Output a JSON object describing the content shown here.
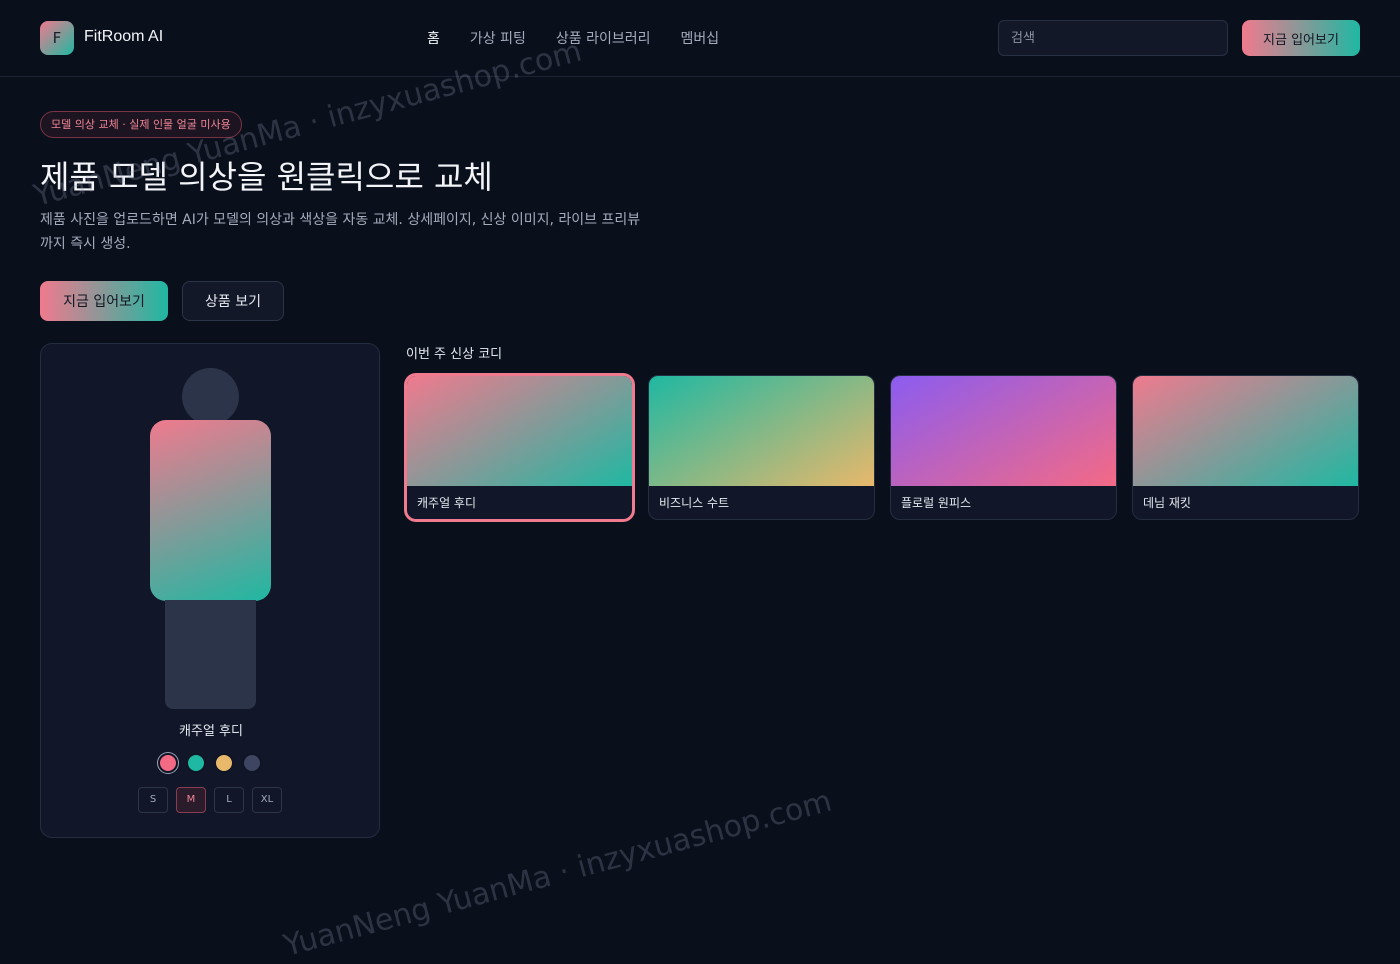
{
  "header": {
    "logo_letter": "F",
    "brand": "FitRoom AI",
    "nav": [
      "홈",
      "가상 피팅",
      "상품 라이브러리",
      "멤버십"
    ],
    "search_placeholder": "검색",
    "cta": "지금 입어보기"
  },
  "hero": {
    "badge": "모델 의상 교체 · 실제 인물 얼굴 미사용",
    "title": "제품 모델 의상을 원클릭으로 교체",
    "description": "제품 사진을 업로드하면 AI가 모델의 의상과 색상을 자동 교체. 상세페이지, 신상 이미지, 라이브 프리뷰까지 즉시 생성.",
    "primary_button": "지금 입어보기",
    "secondary_button": "상품 보기"
  },
  "preview": {
    "item_name": "캐주얼 후디",
    "swatches": [
      "#f46a85",
      "#1fb8a2",
      "#e8b86b",
      "#3d4560"
    ],
    "selected_swatch": 0,
    "sizes": [
      "S",
      "M",
      "L",
      "XL"
    ],
    "selected_size": "M"
  },
  "collection": {
    "title": "이번 주 신상 코디",
    "items": [
      {
        "label": "캐주얼 후디",
        "colors": [
          "#f07a8e",
          "#1fb8a2"
        ]
      },
      {
        "label": "비즈니스 수트",
        "colors": [
          "#1fb8a2",
          "#e8b86b"
        ]
      },
      {
        "label": "플로럴 원피스",
        "colors": [
          "#8b5cf0",
          "#f46a85"
        ]
      },
      {
        "label": "데님 재킷",
        "colors": [
          "#f07a8e",
          "#1fb8a2"
        ]
      }
    ],
    "selected_index": 0
  },
  "watermark": "YuanNeng YuanMa · inzyxuashop.com"
}
